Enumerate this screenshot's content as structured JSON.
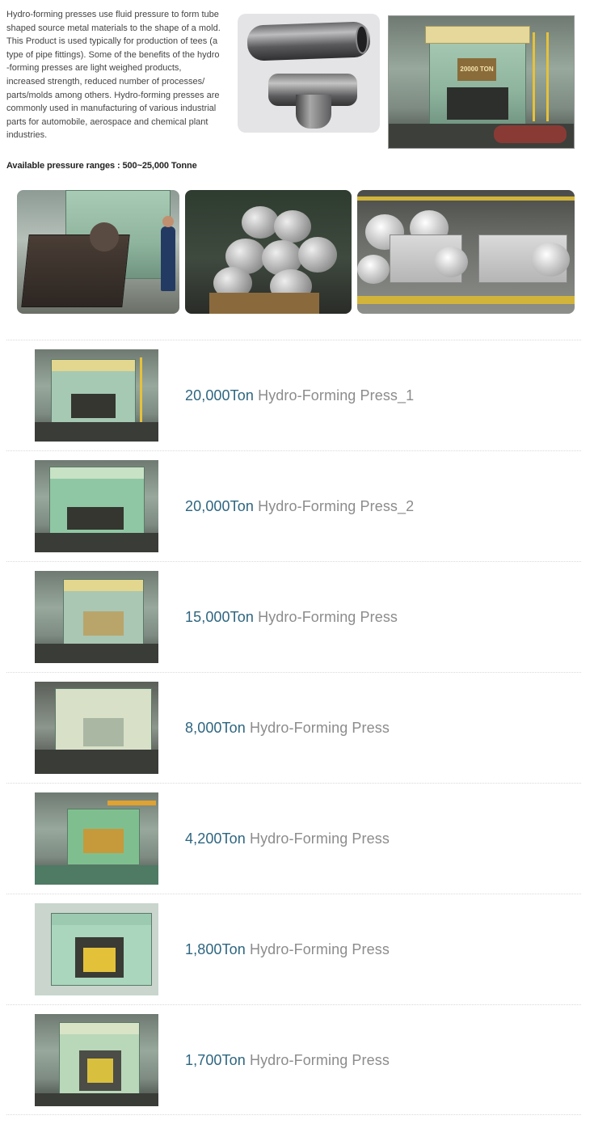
{
  "intro": {
    "lines": [
      "Hydro-forming presses use fluid pressure to form tube",
      "shaped source metal materials to the shape of a mold.",
      "This Product is used typically for production of tees (a",
      "type of pipe fittings). Some of the benefits of the hydro",
      "-forming presses are light weighed products,",
      "increased strength, reduced number of processes/",
      "parts/molds among others. Hydro-forming presses are",
      "commonly used in manufacturing of various industrial",
      "parts for automobile, aerospace and chemical plant",
      "industries."
    ],
    "pressure_label": "Available pressure ranges : 500~25,000 Tonne"
  },
  "big_photo": {
    "sign_text": "20000 TON"
  },
  "colors": {
    "ton_color": "#2e6680",
    "name_color": "#8c8c8c",
    "press_green": "#a8cbb5",
    "press_yellow": "#e3d68e"
  },
  "products": [
    {
      "ton": "20,000Ton",
      "name": "Hydro-Forming Press_1"
    },
    {
      "ton": "20,000Ton",
      "name": "Hydro-Forming Press_2"
    },
    {
      "ton": "15,000Ton",
      "name": "Hydro-Forming Press"
    },
    {
      "ton": "8,000Ton",
      "name": "Hydro-Forming Press"
    },
    {
      "ton": "4,200Ton",
      "name": "Hydro-Forming Press"
    },
    {
      "ton": "1,800Ton",
      "name": "Hydro-Forming Press"
    },
    {
      "ton": "1,700Ton",
      "name": "Hydro-Forming Press"
    }
  ]
}
